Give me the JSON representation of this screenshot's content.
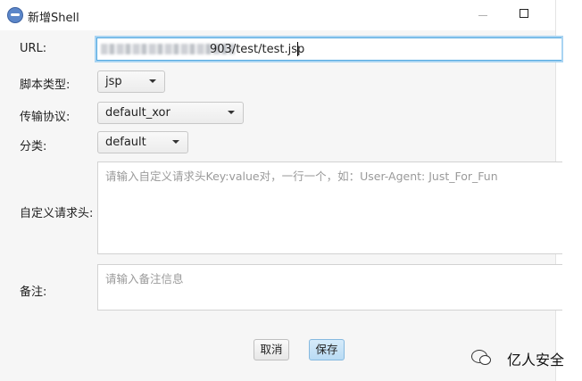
{
  "window": {
    "title": "新增Shell",
    "icon": "shell-app-icon",
    "minimize_icon": "minimize-icon",
    "maximize_icon": "maximize-icon"
  },
  "form": {
    "url": {
      "label": "URL:",
      "value_suffix": "903/test/test.jsp"
    },
    "script_type": {
      "label": "脚本类型:",
      "selected": "jsp"
    },
    "protocol": {
      "label": "传输协议:",
      "selected": "default_xor"
    },
    "category": {
      "label": "分类:",
      "selected": "default"
    },
    "custom_headers": {
      "label": "自定义请求头:",
      "placeholder": "请输入自定义请求头Key:value对，一行一个，如：User-Agent: Just_For_Fun"
    },
    "remark": {
      "label": "备注:",
      "placeholder": "请输入备注信息"
    }
  },
  "buttons": {
    "cancel": "取消",
    "save": "保存"
  },
  "watermark": {
    "text": "亿人安全",
    "icon": "wechat-icon"
  }
}
